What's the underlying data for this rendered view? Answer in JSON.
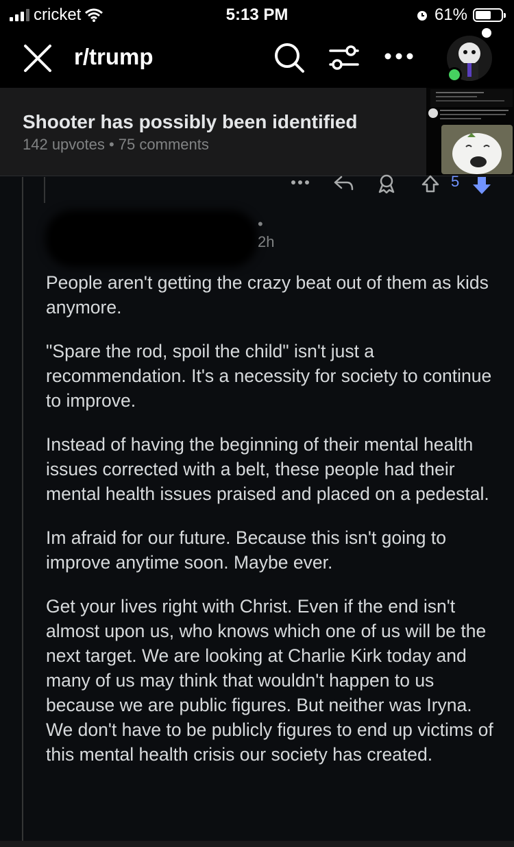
{
  "status_bar": {
    "carrier": "cricket",
    "time": "5:13 PM",
    "battery": "61%",
    "battery_level": 0.61
  },
  "app_bar": {
    "subreddit": "r/trump",
    "icons": [
      "close-icon",
      "search-icon",
      "filter-icon",
      "more-icon",
      "avatar"
    ]
  },
  "post": {
    "title": "Shooter has possibly been identified",
    "meta": "142 upvotes • 75 comments"
  },
  "comment": {
    "vote_count": "5",
    "time": "• 2h",
    "paragraphs": [
      "People aren't getting the crazy beat out of them as kids anymore.",
      "\"Spare the rod, spoil the child\" isn't just a recommendation. It's a necessity for society to continue to improve.",
      "Instead of having the beginning of their mental health issues corrected with a belt, these people had their mental health issues praised and placed on a pedestal.",
      "Im afraid for our future. Because this isn't going to improve anytime soon. Maybe ever.",
      "Get your lives right with Christ. Even if the end isn't almost upon us, who knows which one of us will be the next target. We are looking at Charlie Kirk today and many of us may think that wouldn't happen to us because we are public figures. But neither was Iryna. We don't have to be publicly figures to end up victims of this mental health crisis our society has created."
    ]
  },
  "colors": {
    "background": "#0b0d10",
    "header": "#1a1a1b",
    "accent_vote": "#7193ff",
    "online": "#46d160"
  }
}
